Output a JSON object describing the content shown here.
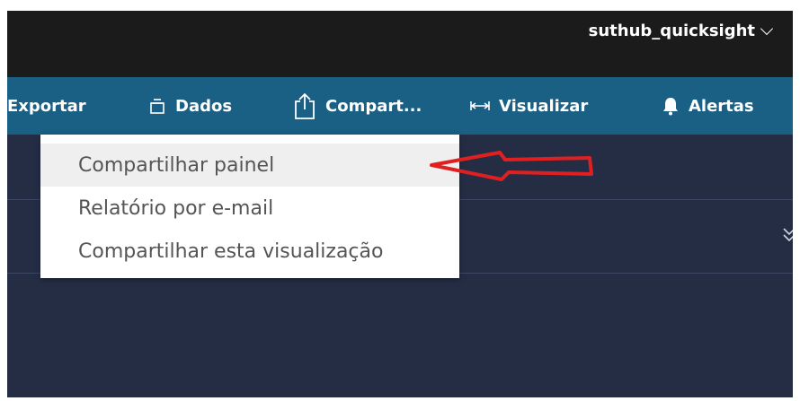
{
  "header": {
    "user_menu_label": "suthub_quicksight"
  },
  "toolbar": {
    "items": [
      {
        "label": "Exportar",
        "icon": "export"
      },
      {
        "label": "Dados",
        "icon": "database-icon"
      },
      {
        "label": "Compart...",
        "icon": "share-icon"
      },
      {
        "label": "Visualizar",
        "icon": "expand-horizontal-icon"
      },
      {
        "label": "Alertas",
        "icon": "bell-icon"
      }
    ]
  },
  "share_menu": {
    "items": [
      {
        "label": "Compartilhar painel",
        "highlighted": true
      },
      {
        "label": "Relatório por e-mail",
        "highlighted": false
      },
      {
        "label": "Compartilhar esta visualização",
        "highlighted": false
      }
    ]
  },
  "annotation": {
    "arrow_icon": "red-arrow-left-icon",
    "arrow_color": "#e02020"
  },
  "colors": {
    "toolbar": "#1a5f84",
    "topbar": "#1b1b1b",
    "background": "#252d45"
  }
}
